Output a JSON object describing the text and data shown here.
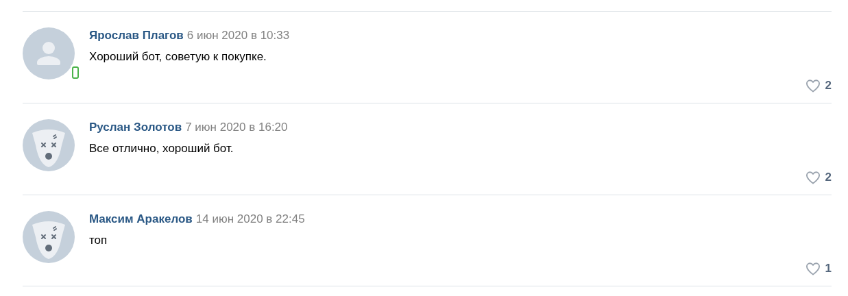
{
  "comments": [
    {
      "author": "Ярослав Плагов",
      "date": "6 июн 2020 в 10:33",
      "text": "Хороший бот, советую к покупке.",
      "kind": "person",
      "online_mobile": true,
      "likes": "2"
    },
    {
      "author": "Руслан Золотов",
      "date": "7 июн 2020 в 16:20",
      "text": "Все отлично, хороший бот.",
      "kind": "dog",
      "online_mobile": false,
      "likes": "2"
    },
    {
      "author": "Максим Аракелов",
      "date": "14 июн 2020 в 22:45",
      "text": "топ",
      "kind": "dog",
      "online_mobile": false,
      "likes": "1"
    }
  ]
}
